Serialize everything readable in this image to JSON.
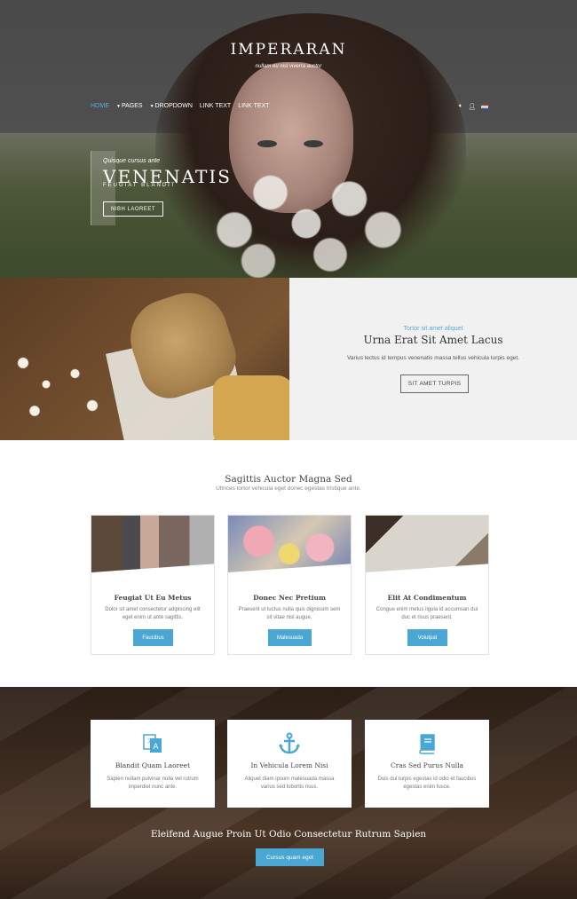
{
  "header": {
    "brand": "IMPERARAN",
    "tagline": "nullam eu nisl viverra auctor"
  },
  "nav": {
    "items": [
      {
        "label": "HOME",
        "active": true,
        "caret": false
      },
      {
        "label": "PAGES",
        "active": false,
        "caret": true
      },
      {
        "label": "DROPDOWN",
        "active": false,
        "caret": true
      },
      {
        "label": "LINK TEXT",
        "active": false,
        "caret": false
      },
      {
        "label": "LINK TEXT",
        "active": false,
        "caret": false
      }
    ],
    "icons": [
      "volume-icon",
      "user-plus-icon",
      "flag-us-icon"
    ]
  },
  "hero": {
    "kicker": "Quisque cursus ante",
    "title": "VENENATIS",
    "subtitle": "FEUGIAT BLANDIT",
    "button": "NIBH LAOREET"
  },
  "feature": {
    "kicker": "Tortor sit amet aliquet",
    "title": "Urna Erat Sit Amet Lacus",
    "description": "Varius lectus id tempus venenatis massa tellus vehicula turpis eget.",
    "button": "SIT AMET TURPIS"
  },
  "section": {
    "title": "Sagittis Auctor Magna Sed",
    "subtitle": "Ultrices tortor vehicula eget donec egestas tristique ante."
  },
  "cards": [
    {
      "title": "Feugiat Ut Eu Metus",
      "description": "Dolor sit amet consectetur adipiscing elit eget enim ut ante sagittis.",
      "button": "Faucibus"
    },
    {
      "title": "Donec Nec Pretium",
      "description": "Praesent ut luctus nulla quis dignissim sem sit vitae nisl augue.",
      "button": "Malesuada"
    },
    {
      "title": "Elit At Condimentum",
      "description": "Congue enim metus ligula id accumsan dui duc et risus praesent.",
      "button": "Volutpat"
    }
  ],
  "dark_cards": [
    {
      "icon": "translate-icon",
      "title": "Blandit Quam Laoreet",
      "description": "Sapien nullam pulvinar nulla vel rutrum imperdiet nunc ante."
    },
    {
      "icon": "anchor-icon",
      "title": "In Vehicula Lorem Nisi",
      "description": "Aliquet diam ipsum malesuada massa varius sed lobortis risus."
    },
    {
      "icon": "book-icon",
      "title": "Cras Sed Purus Nulla",
      "description": "Duis dui turpis egestas id odio et faucibus egestas enim fusce."
    }
  ],
  "cta": {
    "title": "Eleifend Augue Proin Ut Odio Consectetur Rutrum Sapien",
    "button": "Cursus quam eget"
  },
  "colors": {
    "accent": "#4aa7d4",
    "nav_active": "#5aaad6"
  }
}
